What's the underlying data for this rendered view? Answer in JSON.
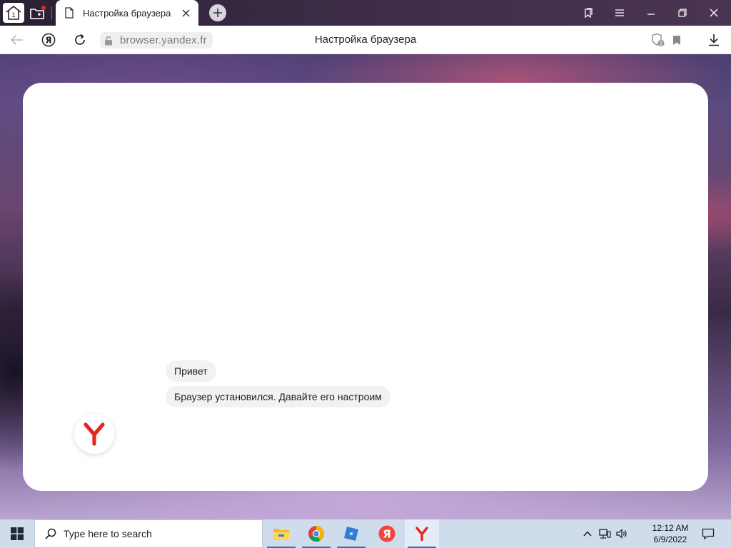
{
  "window": {
    "tab_title": "Настройка браузера",
    "colors": {
      "accent": "#e52620",
      "notification_dot": "#e52620",
      "taskbar": "#cfdcec"
    }
  },
  "tabstrip": {
    "home_icon": "home-icon",
    "home_badge": "1",
    "new_tab_icon": "new-tab-icon",
    "close_tab_icon": "close-icon",
    "add_tab_icon": "plus-icon",
    "window_controls": [
      "collections-icon",
      "menu-icon",
      "minimize-icon",
      "restore-icon",
      "close-icon"
    ]
  },
  "toolbar": {
    "back_icon": "arrow-left-icon",
    "yandex_icon": "yandex-ya-icon",
    "reload_icon": "reload-icon",
    "lock_icon": "lock-icon",
    "url": "browser.yandex.fr",
    "page_title": "Настройка браузера",
    "protect_badge": "1",
    "bookmark_icon": "bookmark-icon",
    "download_icon": "download-icon"
  },
  "setup": {
    "messages": [
      "Привет",
      "Браузер установился. Давайте его настроим"
    ],
    "avatar_letter": "Y"
  },
  "taskbar": {
    "search_placeholder": "Type here to search",
    "apps": [
      "file-explorer-icon",
      "chrome-icon",
      "roblox-icon",
      "yandex-icon",
      "yandex-browser-icon"
    ],
    "time": "12:12 AM",
    "date": "6/9/2022"
  }
}
